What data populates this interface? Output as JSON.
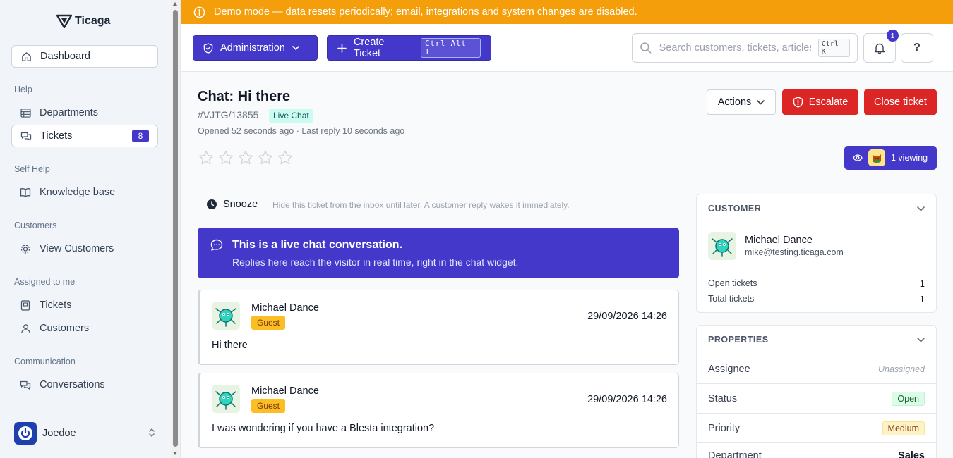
{
  "app": {
    "logo_text": "Ticaga"
  },
  "sidebar": {
    "dashboard": "Dashboard",
    "sections": {
      "help": "Help",
      "self_help": "Self Help",
      "customers": "Customers",
      "assigned": "Assigned to me",
      "communication": "Communication"
    },
    "items": {
      "departments": "Departments",
      "tickets": "Tickets",
      "tickets_count": "8",
      "knowledge_base": "Knowledge base",
      "view_customers": "View Customers",
      "assigned_tickets": "Tickets",
      "assigned_customers": "Customers",
      "conversations": "Conversations"
    },
    "user": {
      "name": "Joedoe"
    }
  },
  "banner": {
    "text": "Demo mode — data resets periodically; email, integrations and system changes are disabled."
  },
  "topbar": {
    "administration": "Administration",
    "create_ticket": "Create Ticket",
    "create_ticket_shortcut": "Ctrl Alt T",
    "search_placeholder": "Search customers, tickets, articles",
    "search_shortcut": "Ctrl K",
    "notifications_count": "1",
    "help_label": "?"
  },
  "ticket": {
    "title": "Chat: Hi there",
    "id": "#VJTG/13855",
    "channel_tag": "Live Chat",
    "meta": "Opened 52 seconds ago · Last reply 10 seconds ago",
    "rating": 0,
    "rating_max": 5,
    "actions": "Actions",
    "escalate": "Escalate",
    "close": "Close ticket",
    "viewing": "1 viewing"
  },
  "snooze": {
    "label": "Snooze",
    "description": "Hide this ticket from the inbox until later. A customer reply wakes it immediately."
  },
  "chat_banner": {
    "title": "This is a live chat conversation.",
    "description": "Replies here reach the visitor in real time, right in the chat widget."
  },
  "messages": [
    {
      "author": "Michael Dance",
      "role": "Guest",
      "time": "29/09/2026 14:26",
      "body": "Hi there"
    },
    {
      "author": "Michael Dance",
      "role": "Guest",
      "time": "29/09/2026 14:26",
      "body": "I was wondering if you have a Blesta integration?"
    }
  ],
  "customer_card": {
    "heading": "CUSTOMER",
    "name": "Michael Dance",
    "email": "mike@testing.ticaga.com",
    "open_tickets_label": "Open tickets",
    "open_tickets": "1",
    "total_tickets_label": "Total tickets",
    "total_tickets": "1"
  },
  "properties_card": {
    "heading": "PROPERTIES",
    "assignee_label": "Assignee",
    "assignee": "Unassigned",
    "status_label": "Status",
    "status": "Open",
    "priority_label": "Priority",
    "priority": "Medium",
    "department_label": "Department",
    "department": "Sales"
  },
  "colors": {
    "brand": "#4338ca",
    "banner": "#f59e0b",
    "danger": "#dc2626"
  }
}
